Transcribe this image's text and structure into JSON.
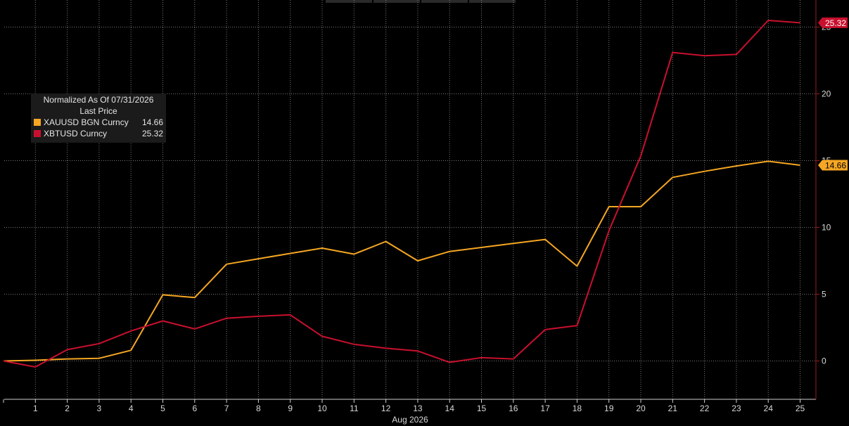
{
  "legend": {
    "title": "Normalized As Of 07/31/2026",
    "subtitle": "Last Price",
    "items": [
      {
        "name": "XAUUSD BGN Curncy",
        "value": "14.66",
        "color": "#f5a623"
      },
      {
        "name": "XBTUSD Curncy",
        "value": "25.32",
        "color": "#c8102e"
      }
    ]
  },
  "chart_data": {
    "type": "line",
    "xlabel": "Aug 2026",
    "x": [
      0,
      1,
      2,
      3,
      4,
      5,
      6,
      7,
      8,
      9,
      10,
      11,
      12,
      13,
      14,
      15,
      16,
      17,
      18,
      19,
      20,
      21,
      22,
      23,
      24,
      25
    ],
    "x_tick_labels": [
      "1",
      "2",
      "3",
      "4",
      "5",
      "6",
      "7",
      "8",
      "9",
      "10",
      "11",
      "12",
      "13",
      "14",
      "15",
      "16",
      "17",
      "18",
      "19",
      "20",
      "21",
      "22",
      "23",
      "24",
      "25"
    ],
    "y_ticks": [
      0,
      5,
      10,
      15,
      20,
      25
    ],
    "ylim": [
      -2.8,
      26.8
    ],
    "grid": true,
    "legend_position": "top-left",
    "series": [
      {
        "name": "XAUUSD BGN Curncy",
        "color": "#f5a623",
        "last_label": "14.66",
        "values": [
          0.0,
          0.05,
          0.15,
          0.2,
          0.8,
          4.95,
          4.75,
          7.25,
          7.65,
          8.05,
          8.45,
          8.0,
          8.95,
          7.5,
          8.2,
          8.5,
          8.8,
          9.1,
          7.1,
          11.55,
          11.55,
          13.75,
          14.2,
          14.6,
          14.95,
          14.66
        ]
      },
      {
        "name": "XBTUSD Curncy",
        "color": "#c8102e",
        "last_label": "25.32",
        "values": [
          0.0,
          -0.45,
          0.85,
          1.3,
          2.25,
          3.0,
          2.4,
          3.2,
          3.35,
          3.45,
          1.85,
          1.25,
          0.95,
          0.75,
          -0.1,
          0.25,
          0.15,
          2.35,
          2.65,
          9.75,
          15.35,
          23.1,
          22.85,
          22.95,
          25.5,
          25.32
        ]
      }
    ]
  }
}
